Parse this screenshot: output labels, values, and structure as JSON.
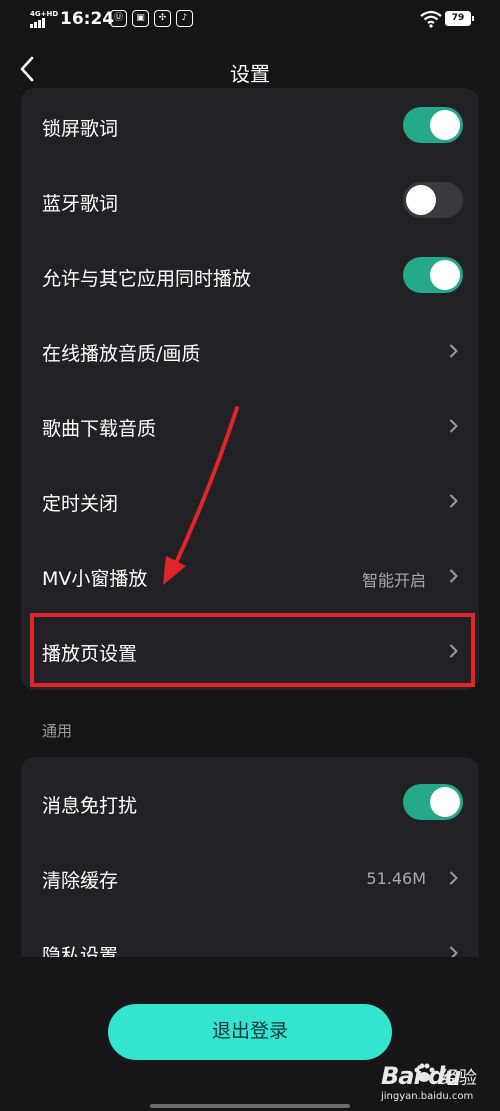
{
  "status_bar": {
    "network": "4G+HD",
    "time": "16:24",
    "battery": "79",
    "notification_icons": [
      "hd-icon",
      "app-icon",
      "fan-icon",
      "tiktok-icon"
    ]
  },
  "header": {
    "title": "设置",
    "back_icon": "chevron-left-icon"
  },
  "playback_section": {
    "items": [
      {
        "label": "锁屏歌词",
        "control": "toggle",
        "state": "on"
      },
      {
        "label": "蓝牙歌词",
        "control": "toggle",
        "state": "off"
      },
      {
        "label": "允许与其它应用同时播放",
        "control": "toggle",
        "state": "on"
      },
      {
        "label": "在线播放音质/画质",
        "control": "chevron"
      },
      {
        "label": "歌曲下载音质",
        "control": "chevron"
      },
      {
        "label": "定时关闭",
        "control": "chevron"
      },
      {
        "label": "MV小窗播放",
        "control": "chevron",
        "value": "智能开启"
      },
      {
        "label": "播放页设置",
        "control": "chevron"
      }
    ]
  },
  "general_section": {
    "header": "通用",
    "items": [
      {
        "label": "消息免打扰",
        "control": "toggle",
        "state": "on"
      },
      {
        "label": "清除缓存",
        "control": "chevron",
        "value": "51.46M"
      },
      {
        "label": "隐私设置",
        "control": "chevron"
      }
    ]
  },
  "logout": {
    "label": "退出登录"
  },
  "watermark": {
    "brand": "Bai du",
    "brand_cn": "经验",
    "url": "jingyan.baidu.com"
  },
  "colors": {
    "background": "#151517",
    "card": "#222226",
    "toggle_on": "#24a98a",
    "toggle_off": "#3a3a3e",
    "button": "#33e5cf",
    "annotation_red": "#e0242a"
  }
}
